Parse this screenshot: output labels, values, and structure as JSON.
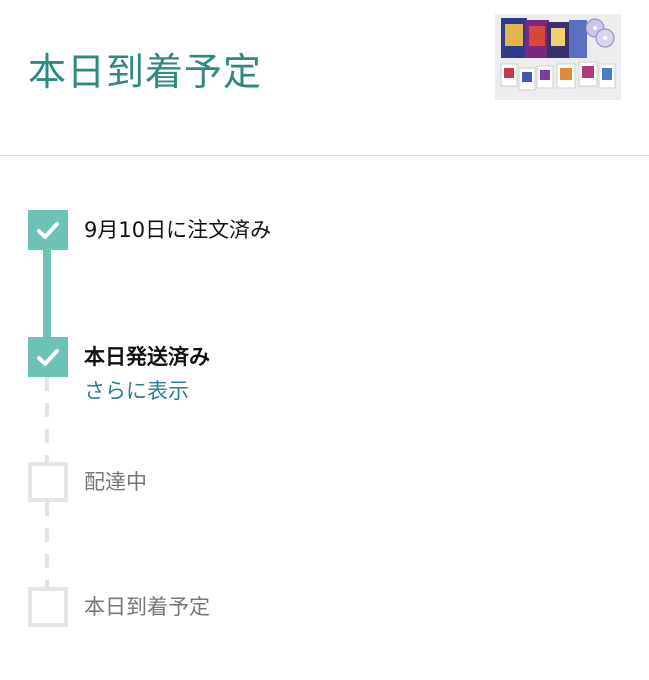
{
  "header": {
    "title": "本日到着予定",
    "thumbnail_icon": "product-image"
  },
  "colors": {
    "accent": "#2e8a80",
    "check": "#6cc2b4",
    "link": "#2b7f95"
  },
  "timeline": {
    "steps": [
      {
        "label": "9月10日に注文済み",
        "status": "done"
      },
      {
        "label": "本日発送済み",
        "status": "done"
      },
      {
        "label": "配達中",
        "status": "pending"
      },
      {
        "label": "本日到着予定",
        "status": "pending"
      }
    ],
    "more_link": "さらに表示"
  }
}
